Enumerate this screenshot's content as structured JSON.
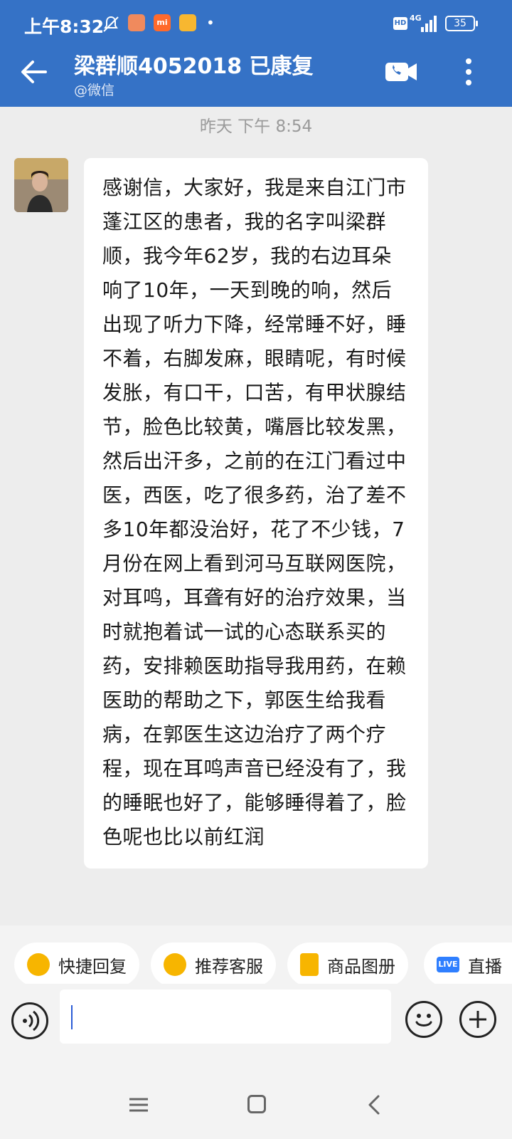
{
  "status_bar": {
    "time": "上午8:32",
    "network": "4G",
    "battery": "35",
    "hd": "HD",
    "app_icon_2_text": "mi"
  },
  "header": {
    "title": "梁群顺4052018 已康复",
    "subtitle": "@微信",
    "accent_color": "#3572c6"
  },
  "chat": {
    "date_label": "昨天  下午 8:54",
    "message": "感谢信，大家好，我是来自江门市蓬江区的患者，我的名字叫梁群顺，我今年62岁，我的右边耳朵响了10年，一天到晚的响，然后出现了听力下降，经常睡不好，睡不着，右脚发麻，眼睛呢，有时候发胀，有口干，口苦，有甲状腺结节，脸色比较黄，嘴唇比较发黑，然后出汗多，之前的在江门看过中医，西医，吃了很多药，治了差不多10年都没治好，花了不少钱，7月份在网上看到河马互联网医院，对耳鸣，耳聋有好的治疗效果，当时就抱着试一试的心态联系买的药，安排赖医助指导我用药，在赖医助的帮助之下，郭医生给我看病，在郭医生这边治疗了两个疗程，现在耳鸣声音已经没有了，我的睡眠也好了，能够睡得着了，脸色呢也比以前红润"
  },
  "quick_replies": [
    {
      "label": "快捷回复",
      "icon": "quick-reply-icon"
    },
    {
      "label": "推荐客服",
      "icon": "recommend-service-icon"
    },
    {
      "label": "商品图册",
      "icon": "product-album-icon"
    },
    {
      "label": "直播",
      "icon": "live-icon",
      "badge": "LIVE"
    }
  ],
  "input": {
    "value": "",
    "placeholder": ""
  },
  "icons": {
    "back": "arrow-left-icon",
    "video": "video-call-icon",
    "more": "more-vertical-icon",
    "voice": "voice-input-icon",
    "emoji": "emoji-icon",
    "plus": "plus-icon"
  }
}
